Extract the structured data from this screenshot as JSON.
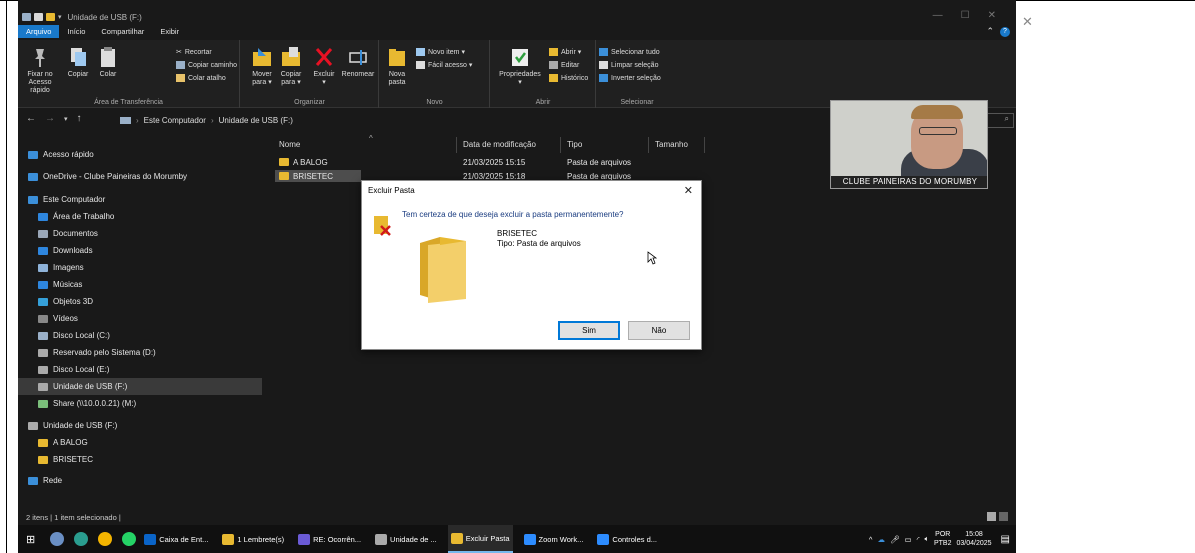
{
  "window": {
    "title": "Unidade de USB (F:)",
    "controls": [
      "—",
      "☐",
      "✕"
    ]
  },
  "ribbon": {
    "tabs": [
      "Arquivo",
      "Início",
      "Compartilhar",
      "Exibir"
    ],
    "active_tab": "Arquivo",
    "groups": {
      "clipboard": {
        "label": "Área de Transferência",
        "pin_line1": "Fixar no",
        "pin_line2": "Acesso rápido",
        "copy": "Copiar",
        "paste": "Colar",
        "cut": "Recortar",
        "copy_path": "Copiar caminho",
        "paste_shortcut": "Colar atalho"
      },
      "organize": {
        "label": "Organizar",
        "move_line1": "Mover",
        "move_line2": "para ▾",
        "copy_line1": "Copiar",
        "copy_line2": "para ▾",
        "delete": "Excluir",
        "delete_arrow": "▾",
        "rename": "Renomear"
      },
      "new": {
        "label": "Novo",
        "new_folder_line1": "Nova",
        "new_folder_line2": "pasta",
        "new_item": "Novo item ▾",
        "easy_access": "Fácil acesso ▾"
      },
      "open": {
        "label": "Abrir",
        "properties": "Propriedades",
        "properties_arrow": "▾",
        "open": "Abrir ▾",
        "edit": "Editar",
        "history": "Histórico"
      },
      "select": {
        "label": "Selecionar",
        "select_all": "Selecionar tudo",
        "select_none": "Limpar seleção",
        "invert": "Inverter seleção"
      }
    }
  },
  "address": {
    "crumbs": [
      "Este Computador",
      "Unidade de USB (F:)"
    ],
    "search_icon": "search-icon"
  },
  "nav_pane": {
    "items": [
      {
        "label": "Acesso rápido",
        "icon": "star-icon",
        "color": "#3b8fd9"
      },
      {
        "label": "OneDrive - Clube Paineiras do Morumby",
        "icon": "cloud-icon",
        "color": "#3b8fd9"
      },
      {
        "label": "Este Computador",
        "icon": "computer-icon",
        "color": "#3b8fd9"
      },
      {
        "label": "Área de Trabalho",
        "icon": "desktop-icon",
        "color": "#2e86de"
      },
      {
        "label": "Documentos",
        "icon": "documents-icon",
        "color": "#9aa7b8"
      },
      {
        "label": "Downloads",
        "icon": "downloads-icon",
        "color": "#2e86de"
      },
      {
        "label": "Imagens",
        "icon": "pictures-icon",
        "color": "#8fb3d9"
      },
      {
        "label": "Músicas",
        "icon": "music-icon",
        "color": "#2e86de"
      },
      {
        "label": "Objetos 3D",
        "icon": "objects3d-icon",
        "color": "#35a0d9"
      },
      {
        "label": "Vídeos",
        "icon": "videos-icon",
        "color": "#888888"
      },
      {
        "label": "Disco Local (C:)",
        "icon": "drive-icon",
        "color": "#9ab0c8"
      },
      {
        "label": "Reservado pelo Sistema (D:)",
        "icon": "drive-icon",
        "color": "#aaaaaa"
      },
      {
        "label": "Disco Local (E:)",
        "icon": "drive-icon",
        "color": "#aaaaaa"
      },
      {
        "label": "Unidade de USB (F:)",
        "icon": "usb-drive-icon",
        "color": "#aaaaaa"
      },
      {
        "label": "Share (\\\\10.0.0.21) (M:)",
        "icon": "network-drive-icon",
        "color": "#7bbf7b"
      },
      {
        "label": "Unidade de USB (F:)",
        "icon": "usb-drive-icon",
        "color": "#aaaaaa"
      },
      {
        "label": "A BALOG",
        "icon": "folder-icon",
        "color": "#e8b931"
      },
      {
        "label": "BRISETEC",
        "icon": "folder-icon",
        "color": "#e8b931"
      },
      {
        "label": "Rede",
        "icon": "network-icon",
        "color": "#3b8fd9"
      }
    ]
  },
  "file_list": {
    "columns": [
      "Nome",
      "Data de modificação",
      "Tipo",
      "Tamanho"
    ],
    "rows": [
      {
        "name": "A BALOG",
        "date": "21/03/2025 15:15",
        "type": "Pasta de arquivos",
        "size": ""
      },
      {
        "name": "BRISETEC",
        "date": "21/03/2025 15:18",
        "type": "Pasta de arquivos",
        "size": ""
      }
    ]
  },
  "dialog": {
    "title": "Excluir Pasta",
    "close": "✕",
    "question": "Tem certeza de que deseja excluir a pasta permanentemente?",
    "item_name": "BRISETEC",
    "item_type": "Tipo: Pasta de arquivos",
    "yes": "Sim",
    "no": "Não"
  },
  "webcam": {
    "caption": "CLUBE PAINEIRAS DO MORUMBY"
  },
  "status": {
    "text": "2 itens  |  1 item selecionado  |"
  },
  "taskbar": {
    "apps": [
      {
        "label": "Caixa de Ent...",
        "color": "#0a64c8",
        "active": false
      },
      {
        "label": "1 Lembrete(s)",
        "color": "#e8b931",
        "active": false
      },
      {
        "label": "RE: Ocorrên...",
        "color": "#6b5bd6",
        "active": false
      },
      {
        "label": "Unidade de ...",
        "color": "#aaaaaa",
        "active": false
      },
      {
        "label": "Excluir Pasta",
        "color": "#e8b931",
        "active": true
      },
      {
        "label": "Zoom Work...",
        "color": "#2d8cff",
        "active": false
      },
      {
        "label": "Controles d...",
        "color": "#2d8cff",
        "active": false
      }
    ],
    "language": "POR",
    "keyboard": "PTB2",
    "time": "15:08",
    "date": "03/04/2025"
  }
}
